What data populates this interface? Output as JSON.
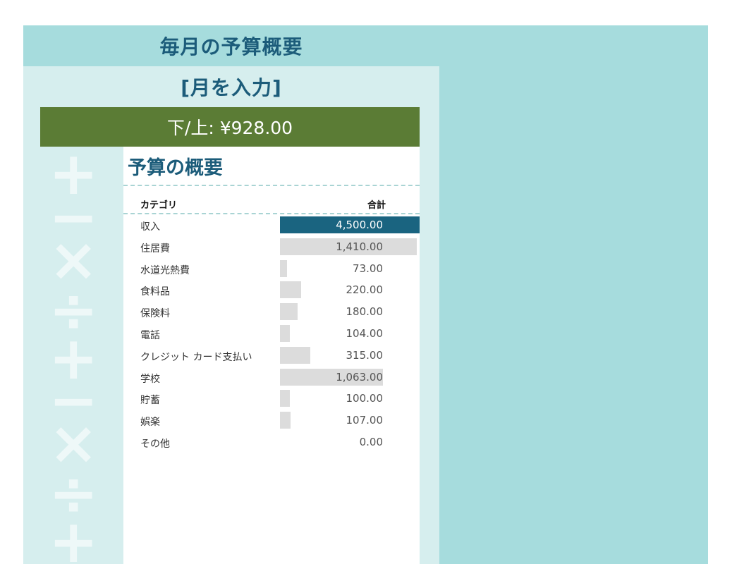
{
  "header": {
    "title": "毎月の予算概要",
    "month_placeholder": "[月を入力]",
    "balance_text": "下/上: ¥928.00"
  },
  "summary": {
    "title": "予算の概要",
    "col_category": "カテゴリ",
    "col_total": "合計"
  },
  "colors": {
    "sheet_bg": "#a6dcdd",
    "panel_bg": "#d6eeee",
    "title_text": "#1c5c7a",
    "balance_bar": "#5b7c35",
    "income_bar": "#1a6480",
    "expense_bar": "#dcdcdc"
  },
  "chart_data": {
    "type": "bar",
    "categories": [
      "収入",
      "住居費",
      "水道光熱費",
      "食料品",
      "保険料",
      "電話",
      "クレジット カード支払い",
      "学校",
      "貯蓄",
      "娯楽",
      "その他"
    ],
    "values": [
      4500,
      1410,
      73,
      220,
      180,
      104,
      315,
      1063,
      100,
      107,
      0
    ],
    "labels": [
      "4,500.00",
      "1,410.00",
      "73.00",
      "220.00",
      "180.00",
      "104.00",
      "315.00",
      "1,063.00",
      "100.00",
      "107.00",
      "0.00"
    ]
  }
}
